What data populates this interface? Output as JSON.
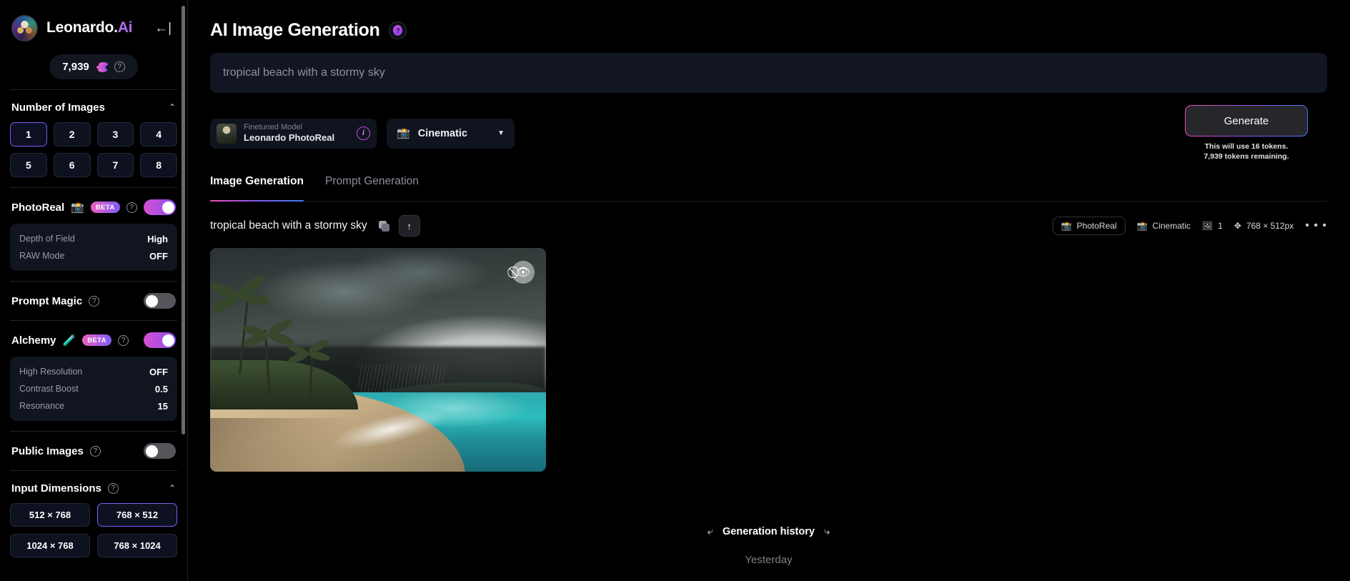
{
  "sidebar": {
    "brand": {
      "name_main": "Leonardo.",
      "name_accent": "Ai",
      "logo_icon": "leonardo-avatar-icon",
      "collapse_icon": "←|"
    },
    "credits": {
      "value": "7,939",
      "coin_icon": "coins-icon",
      "help_icon": "?"
    },
    "number_of_images": {
      "title": "Number of Images",
      "chevron": "⌃",
      "options": [
        "1",
        "2",
        "3",
        "4",
        "5",
        "6",
        "7",
        "8"
      ],
      "selected": "1"
    },
    "photoreal": {
      "label": "PhotoReal",
      "emoji": "📸",
      "badge": "BETA",
      "help_icon": "?",
      "enabled": true,
      "settings": [
        {
          "key": "Depth of Field",
          "value": "High"
        },
        {
          "key": "RAW Mode",
          "value": "OFF"
        }
      ]
    },
    "prompt_magic": {
      "label": "Prompt Magic",
      "help_icon": "?",
      "enabled": false
    },
    "alchemy": {
      "label": "Alchemy",
      "emoji": "🧪",
      "badge": "BETA",
      "help_icon": "?",
      "enabled": true,
      "settings": [
        {
          "key": "High Resolution",
          "value": "OFF"
        },
        {
          "key": "Contrast Boost",
          "value": "0.5"
        },
        {
          "key": "Resonance",
          "value": "15"
        }
      ]
    },
    "public_images": {
      "label": "Public Images",
      "help_icon": "?",
      "enabled": false
    },
    "input_dimensions": {
      "title": "Input Dimensions",
      "help_icon": "?",
      "chevron": "⌃",
      "options": [
        "512 × 768",
        "768 × 512",
        "1024 × 768",
        "768 × 1024"
      ],
      "selected": "768 × 512"
    }
  },
  "main": {
    "page_title": "AI Image Generation",
    "title_badge_icon": "?",
    "prompt": {
      "value": "tropical beach with a stormy sky"
    },
    "model": {
      "kicker": "Finetuned Model",
      "name": "Leonardo PhotoReal",
      "info_icon": "i",
      "thumb_icon": "model-thumbnail"
    },
    "preset": {
      "emoji": "📸",
      "name": "Cinematic",
      "caret": "▼"
    },
    "generate": {
      "label": "Generate",
      "note_line1": "This will use 16 tokens.",
      "note_line2": "7,939 tokens remaining."
    },
    "tabs": [
      {
        "label": "Image Generation",
        "active": true
      },
      {
        "label": "Prompt Generation",
        "active": false
      }
    ],
    "result": {
      "prompt": "tropical beach with a stormy sky",
      "copy_icon": "copy-icon",
      "upload_icon": "↑",
      "chips": [
        {
          "icon": "📸",
          "label": "PhotoReal",
          "boxed": true
        },
        {
          "icon": "📸",
          "label": "Cinematic",
          "boxed": false
        },
        {
          "icon": "🖼",
          "label": "1",
          "boxed": false
        },
        {
          "icon": "✥",
          "label": "768 × 512px",
          "boxed": false
        }
      ],
      "more_icon": "• • •",
      "image_privacy_icon": "eye-slash-icon",
      "image_alt": "tropical beach with stormy sky, palm trees, turquoise water"
    },
    "history": {
      "label": "Generation history",
      "arrow_left": "⤶",
      "arrow_right": "⤷",
      "day_divider": "Yesterday"
    }
  },
  "colors": {
    "accent_purple": "#7b5cf5",
    "accent_pink": "#f04fb0",
    "accent_blue": "#3f7df5",
    "background": "#000000",
    "panel": "#10141e"
  }
}
